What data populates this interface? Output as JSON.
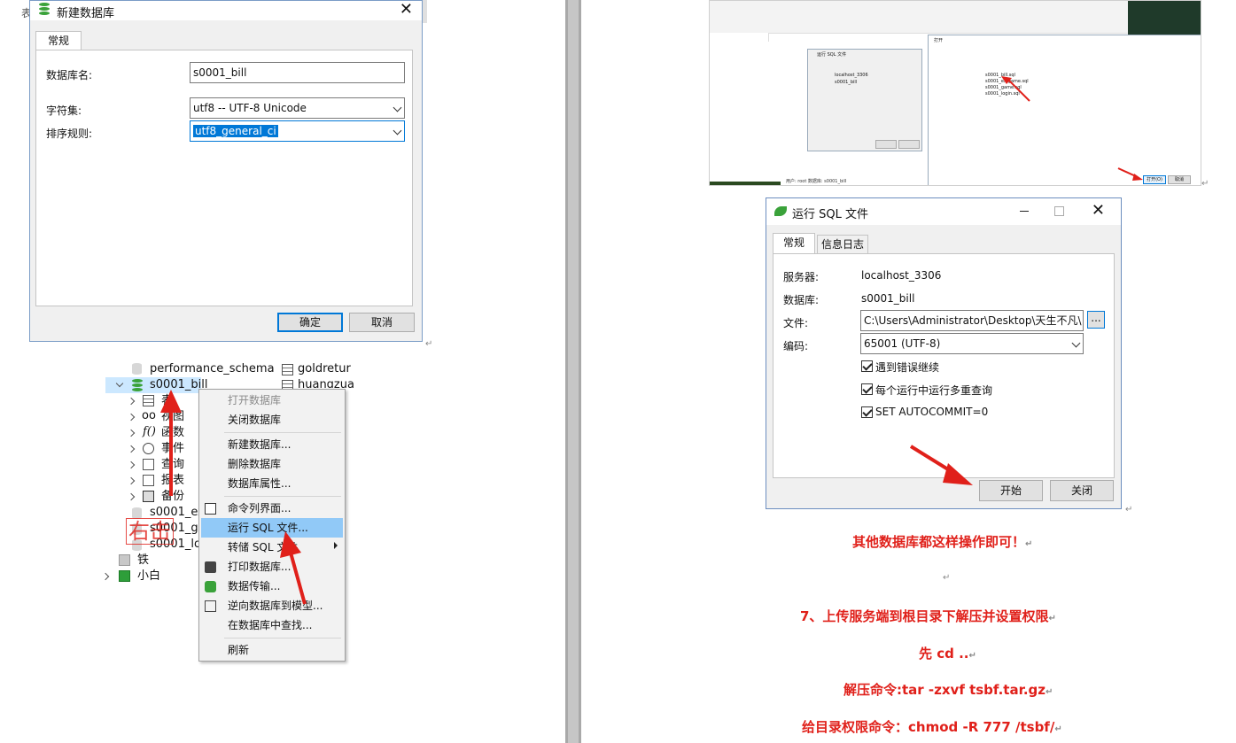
{
  "left_page": {
    "cut_text": "表",
    "new_db_dialog": {
      "title": "新建数据库",
      "tab": "常规",
      "db_name_label": "数据库名:",
      "db_name_value": "s0001_bill",
      "charset_label": "字符集:",
      "charset_value": "utf8 -- UTF-8 Unicode",
      "collation_label": "排序规则:",
      "collation_value": "utf8_general_ci",
      "ok": "确定",
      "cancel": "取消"
    },
    "tree": {
      "items": [
        "performance_schema",
        "s0001_bill",
        "表",
        "视图",
        "函数",
        "事件",
        "查询",
        "报表",
        "备份",
        "s0001_ext",
        "s0001_ga",
        "s0001_log",
        "铁",
        "小白"
      ],
      "right_items": [
        "goldretur",
        "huangzua"
      ],
      "annotation": "右击"
    },
    "context_menu": {
      "items": [
        "打开数据库",
        "关闭数据库",
        "新建数据库...",
        "删除数据库",
        "数据库属性...",
        "命令列界面...",
        "运行 SQL 文件...",
        "转储 SQL 文件",
        "打印数据库...",
        "数据传输...",
        "逆向数据库到模型...",
        "在数据库中查找...",
        "刷新"
      ]
    }
  },
  "right_page": {
    "thumb": {
      "dialog_title": "运行 SQL 文件",
      "open_title": "打开",
      "server": "localhost_3306",
      "db": "s0001_bill",
      "files": [
        "s0001_bill.sql",
        "s0001_extgame.sql",
        "s0001_game.sql",
        "s0001_login.sql"
      ],
      "status": "用户: root   数据库: s0001_bill",
      "open_btn": "打开(O)",
      "cancel_btn": "取消"
    },
    "run_sql_dialog": {
      "title": "运行 SQL 文件",
      "tab_general": "常规",
      "tab_log": "信息日志",
      "server_label": "服务器:",
      "server_value": "localhost_3306",
      "db_label": "数据库:",
      "db_value": "s0001_bill",
      "file_label": "文件:",
      "file_value": "C:\\Users\\Administrator\\Desktop\\天生不凡\\",
      "browse": "...",
      "encoding_label": "编码:",
      "encoding_value": "65001 (UTF-8)",
      "opt1": "遇到错误继续",
      "opt2": "每个运行中运行多重查询",
      "opt3": "SET AUTOCOMMIT=0",
      "start": "开始",
      "close": "关闭"
    },
    "paragraphs": [
      "其他数据库都这样操作即可！",
      "7、上传服务端到根目录下解压并设置权限",
      "先 cd ..",
      "解压命令:tar -zxvf tsbf.tar.gz",
      "给目录权限命令：chmod -R 777 /tsbf/"
    ],
    "return_mark": "↵"
  },
  "colors": {
    "accent": "#0078d7",
    "red": "#e0201a",
    "highlight": "#91c9f7",
    "db_green": "#3aa23a"
  }
}
